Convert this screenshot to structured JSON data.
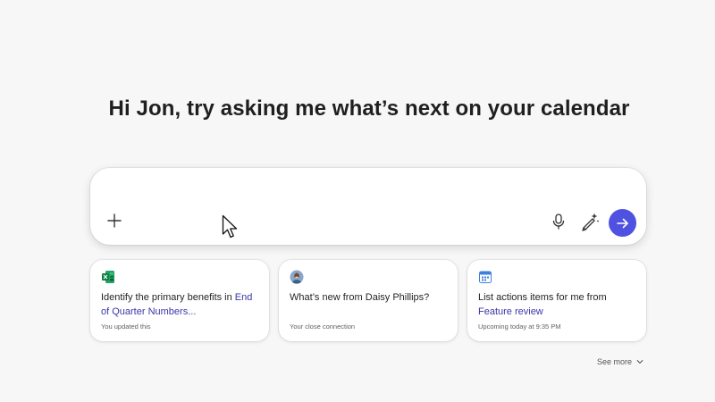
{
  "greeting": "Hi Jon, try asking me what’s next on your calendar",
  "composer": {
    "add_icon": "plus-icon",
    "mic_icon": "microphone-icon",
    "magic_icon": "sparkle-pen-icon",
    "send_icon": "arrow-right-icon",
    "accent_color": "#4f52e0"
  },
  "suggestions": [
    {
      "icon": "excel-icon",
      "text": "Identify the primary benefits in ",
      "link": "End of Quarter Numbers...",
      "meta": "You updated this"
    },
    {
      "icon": "avatar-icon",
      "text": "What’s new from Daisy Phillips?",
      "link": "",
      "meta": "Your close connection"
    },
    {
      "icon": "calendar-icon",
      "text": "List actions items for me from ",
      "link": "Feature review",
      "meta": "Upcoming today at 9:35 PM"
    }
  ],
  "see_more": "See more"
}
